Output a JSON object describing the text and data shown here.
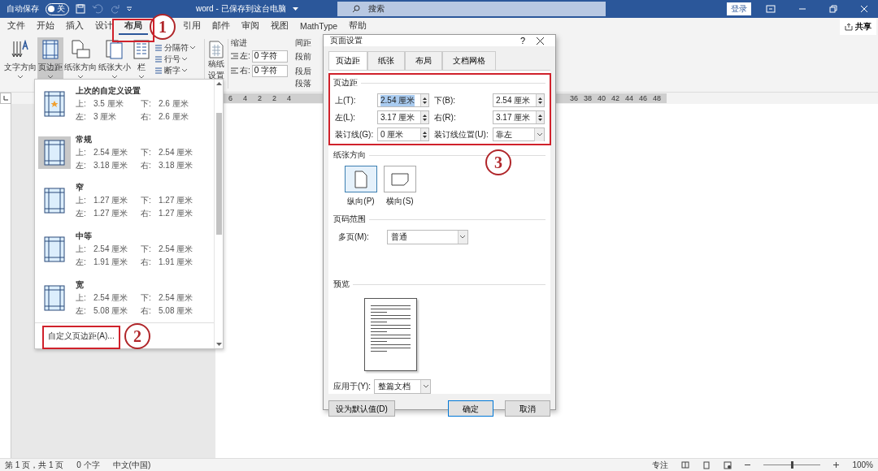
{
  "title_bar": {
    "autosave_label": "自动保存",
    "autosave_toggle": {
      "label": "关",
      "on": false
    },
    "title": "word - 已保存到这台电脑",
    "search_placeholder": "搜索",
    "login": "登录"
  },
  "menu_tabs": [
    {
      "label": "文件",
      "selected": false
    },
    {
      "label": "开始",
      "selected": false
    },
    {
      "label": "插入",
      "selected": false
    },
    {
      "label": "设计",
      "selected": false
    },
    {
      "label": "布局",
      "selected": true
    },
    {
      "label": "引用",
      "selected": false
    },
    {
      "label": "邮件",
      "selected": false
    },
    {
      "label": "审阅",
      "selected": false
    },
    {
      "label": "视图",
      "selected": false
    },
    {
      "label": "MathType",
      "selected": false
    },
    {
      "label": "帮助",
      "selected": false
    }
  ],
  "share": "共享",
  "ribbon": {
    "big_buttons": [
      {
        "label": "文字方向",
        "kind": "text",
        "selected": false
      },
      {
        "label": "页边距",
        "kind": "margins",
        "selected": true
      },
      {
        "label": "纸张方向",
        "kind": "orientation",
        "selected": false
      },
      {
        "label": "纸张大小",
        "kind": "size",
        "selected": false
      },
      {
        "label": "栏",
        "kind": "columns",
        "selected": false
      }
    ],
    "small_buttons": [
      "分隔符",
      "行号",
      "断字"
    ],
    "draft": [
      "稿纸",
      "设置"
    ],
    "indent": {
      "title": "缩进",
      "left_label": "左:",
      "left_value": "0 字符",
      "right_label": "右:",
      "right_value": "0 字符"
    },
    "spacing": {
      "title": "间距",
      "before": "段前",
      "after": "段后"
    },
    "group_label": "段落"
  },
  "ruler": {
    "left_marks": [
      "6",
      "4",
      "2",
      "2",
      "4"
    ],
    "right_marks": [
      "36",
      "38",
      "40",
      "42",
      "44",
      "46",
      "48"
    ]
  },
  "margins_menu": {
    "items": [
      {
        "name": "上次的自定义设置",
        "kind": "starred",
        "selected": false,
        "rows": [
          [
            "上:",
            "3.5 厘米",
            "下:",
            "2.6 厘米"
          ],
          [
            "左:",
            "3 厘米",
            "右:",
            "2.6 厘米"
          ]
        ]
      },
      {
        "name": "常规",
        "kind": "plain",
        "selected": true,
        "rows": [
          [
            "上:",
            "2.54 厘米",
            "下:",
            "2.54 厘米"
          ],
          [
            "左:",
            "3.18 厘米",
            "右:",
            "3.18 厘米"
          ]
        ]
      },
      {
        "name": "窄",
        "kind": "plain",
        "selected": false,
        "rows": [
          [
            "上:",
            "1.27 厘米",
            "下:",
            "1.27 厘米"
          ],
          [
            "左:",
            "1.27 厘米",
            "右:",
            "1.27 厘米"
          ]
        ]
      },
      {
        "name": "中等",
        "kind": "plain",
        "selected": false,
        "rows": [
          [
            "上:",
            "2.54 厘米",
            "下:",
            "2.54 厘米"
          ],
          [
            "左:",
            "1.91 厘米",
            "右:",
            "1.91 厘米"
          ]
        ]
      },
      {
        "name": "宽",
        "kind": "plain",
        "selected": false,
        "rows": [
          [
            "上:",
            "2.54 厘米",
            "下:",
            "2.54 厘米"
          ],
          [
            "左:",
            "5.08 厘米",
            "右:",
            "5.08 厘米"
          ]
        ]
      }
    ],
    "footer": "自定义页边距(A)..."
  },
  "dialog": {
    "title": "页面设置",
    "help": "?",
    "tabs": [
      {
        "label": "页边距",
        "selected": true
      },
      {
        "label": "纸张",
        "selected": false
      },
      {
        "label": "布局",
        "selected": false
      },
      {
        "label": "文档网格",
        "selected": false
      }
    ],
    "margins_title": "页边距",
    "fields": [
      {
        "label": "上(T):",
        "value": "2.54 厘米",
        "kind": "spin",
        "selected": true
      },
      {
        "label": "下(B):",
        "value": "2.54 厘米",
        "kind": "spin",
        "selected": false
      },
      {
        "label": "左(L):",
        "value": "3.17 厘米",
        "kind": "spin",
        "selected": false
      },
      {
        "label": "右(R):",
        "value": "3.17 厘米",
        "kind": "spin",
        "selected": false
      },
      {
        "label": "装订线(G):",
        "value": "0 厘米",
        "kind": "spin",
        "selected": false
      },
      {
        "label": "装订线位置(U):",
        "value": "靠左",
        "kind": "select",
        "selected": false
      }
    ],
    "orientation_title": "纸张方向",
    "orientations": [
      {
        "label": "纵向(P)",
        "kind": "portrait",
        "selected": true
      },
      {
        "label": "横向(S)",
        "kind": "landscape",
        "selected": false
      }
    ],
    "pages_title": "页码范围",
    "pages_label": "多页(M):",
    "pages_value": "普通",
    "preview_title": "预览",
    "apply_label": "应用于(Y):",
    "apply_value": "整篇文档",
    "default_button": "设为默认值(D)",
    "ok": "确定",
    "cancel": "取消"
  },
  "status_bar": {
    "page": "第 1 页，共 1 页",
    "words": "0 个字",
    "language": "中文(中国)",
    "focus": "专注",
    "zoom_slider": {
      "level": 0.5
    },
    "zoom": "100%"
  },
  "annotations": [
    "1",
    "2",
    "3"
  ]
}
